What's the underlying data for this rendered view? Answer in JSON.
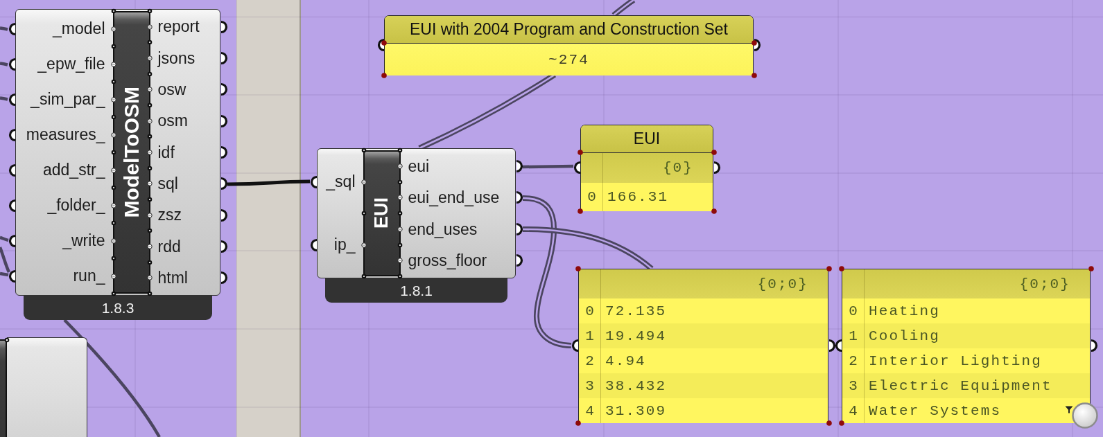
{
  "components": [
    {
      "nickname": "ModelToOSM",
      "version": "1.8.3",
      "inputs": [
        "_model",
        "_epw_file",
        "_sim_par_",
        "measures_",
        "add_str_",
        "_folder_",
        "_write",
        "run_"
      ],
      "outputs": [
        "report",
        "jsons",
        "osw",
        "osm",
        "idf",
        "sql",
        "zsz",
        "rdd",
        "html"
      ]
    },
    {
      "nickname": "EUI",
      "version": "1.8.1",
      "inputs": [
        "_sql",
        "ip_"
      ],
      "outputs": [
        "eui",
        "eui_end_use",
        "end_uses",
        "gross_floor"
      ]
    }
  ],
  "panels": [
    {
      "kind": "text",
      "title": "EUI with 2004 Program and Construction Set",
      "text": "~274"
    },
    {
      "kind": "list",
      "title": "EUI",
      "path": "{0}",
      "rows": [
        {
          "index": "0",
          "value": "166.31"
        }
      ]
    },
    {
      "kind": "list",
      "path": "{0;0}",
      "rows": [
        {
          "index": "0",
          "value": "72.135"
        },
        {
          "index": "1",
          "value": "19.494"
        },
        {
          "index": "2",
          "value": "4.94"
        },
        {
          "index": "3",
          "value": "38.432"
        },
        {
          "index": "4",
          "value": "31.309"
        }
      ]
    },
    {
      "kind": "list",
      "path": "{0;0}",
      "rows": [
        {
          "index": "0",
          "value": "Heating"
        },
        {
          "index": "1",
          "value": "Cooling"
        },
        {
          "index": "2",
          "value": "Interior Lighting"
        },
        {
          "index": "3",
          "value": "Electric Equipment"
        },
        {
          "index": "4",
          "value": "Water Systems"
        }
      ]
    }
  ],
  "canvas": {
    "wires": [
      {
        "kind": "single",
        "highlighted": false
      },
      {
        "kind": "single",
        "highlighted": false
      },
      {
        "kind": "single",
        "highlighted": false
      },
      {
        "kind": "single",
        "highlighted": false
      },
      {
        "kind": "single",
        "highlighted": false
      },
      {
        "kind": "single",
        "highlighted": false
      },
      {
        "kind": "single",
        "highlighted": false
      },
      {
        "kind": "single",
        "highlighted": true
      },
      {
        "kind": "double",
        "highlighted": false
      },
      {
        "kind": "double",
        "highlighted": false
      },
      {
        "kind": "single",
        "highlighted": false
      },
      {
        "kind": "double",
        "highlighted": false
      },
      {
        "kind": "double",
        "highlighted": false
      }
    ]
  }
}
